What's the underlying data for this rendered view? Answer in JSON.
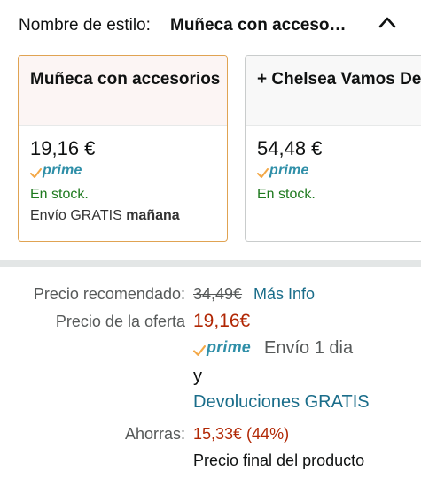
{
  "style_selector": {
    "label": "Nombre de estilo:",
    "value": "Muñeca con acceso…",
    "icon": "chevron-up-icon"
  },
  "variants": [
    {
      "title": "Muñeca con accesorios",
      "price": "19,16 €",
      "prime": "prime",
      "stock": "En stock.",
      "shipping_prefix": "Envío GRATIS",
      "shipping_day": "mañana",
      "selected": true
    },
    {
      "title": "+ Chelsea Vamos De",
      "price": "54,48 €",
      "prime": "prime",
      "stock": "En stock.",
      "selected": false
    }
  ],
  "pricing": {
    "list_price_label": "Precio recomendado:",
    "list_price": "34,49€",
    "more_info": "Más Info",
    "deal_label": "Precio de la oferta",
    "deal_price": "19,16€",
    "prime": "prime",
    "prime_shipping": "Envío 1 dia",
    "conjunction": "y",
    "returns": "Devoluciones GRATIS",
    "savings_label": "Ahorras:",
    "savings": "15,33€ (44%)",
    "final_note": "Precio final del producto"
  },
  "colors": {
    "selected_border": "#e0a352",
    "prime_blue": "#2f8fa8",
    "prime_check": "#f3a847",
    "in_stock_green": "#1f7a1f",
    "deal_red": "#b12704",
    "link_teal": "#1a6d8a"
  }
}
